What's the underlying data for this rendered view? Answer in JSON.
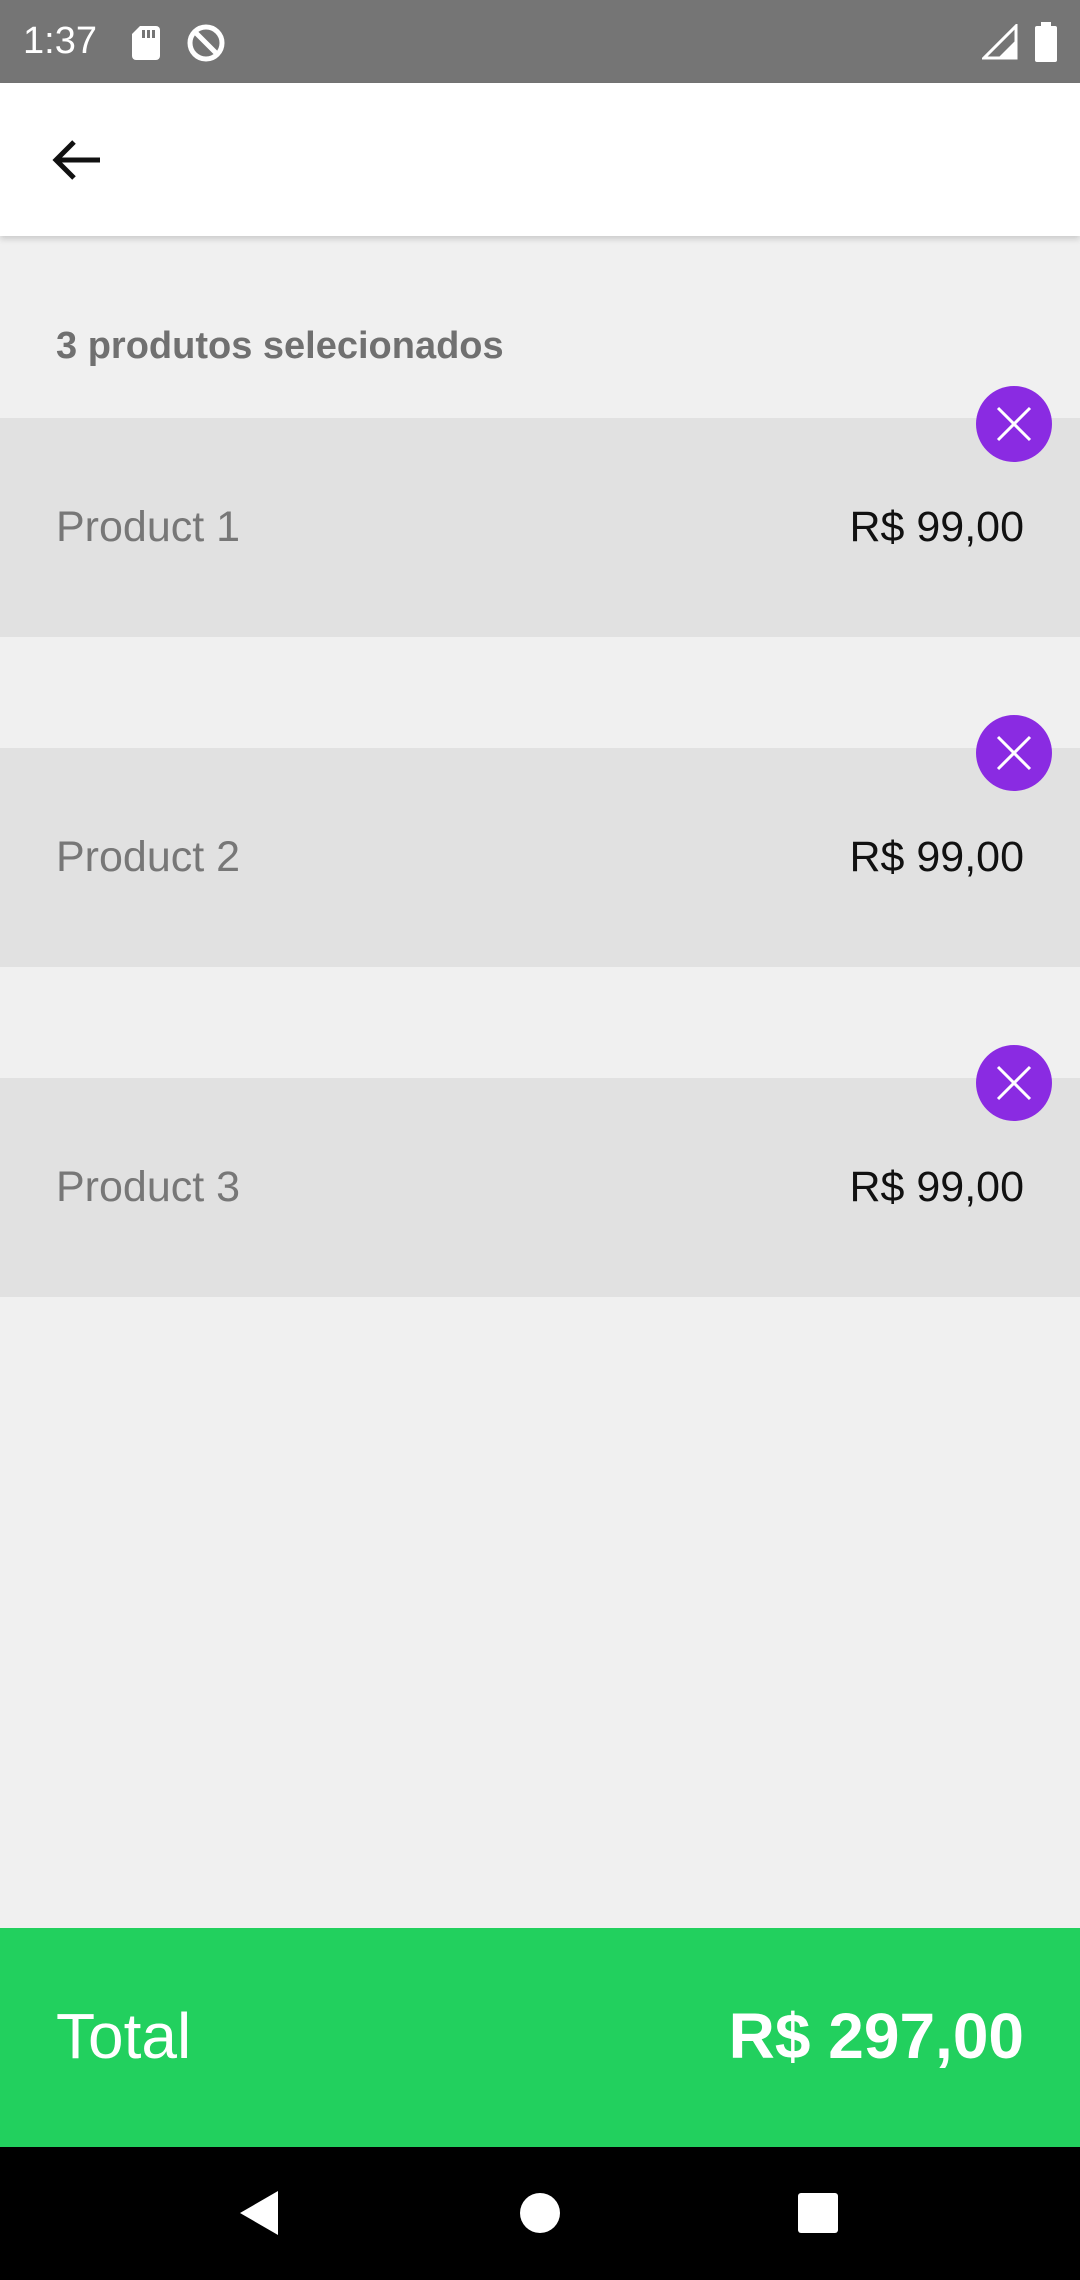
{
  "status_bar": {
    "time": "1:37",
    "icons": [
      "sd-card-icon",
      "data-saver-icon",
      "signal-icon",
      "battery-icon"
    ]
  },
  "app_bar": {
    "back_icon": "arrow-left-icon"
  },
  "cart": {
    "summary": "3 produtos selecionados",
    "items": [
      {
        "name": "Product 1",
        "price": "R$ 99,00"
      },
      {
        "name": "Product 2",
        "price": "R$ 99,00"
      },
      {
        "name": "Product 3",
        "price": "R$ 99,00"
      }
    ],
    "remove_icon": "close-icon"
  },
  "total": {
    "label": "Total",
    "value": "R$ 297,00"
  },
  "colors": {
    "accent": "#8a2be2",
    "total_bar": "#22d05e",
    "status_bar": "#757575"
  },
  "nav_bar": {
    "icons": [
      "back-triangle-icon",
      "home-circle-icon",
      "recents-square-icon"
    ]
  }
}
